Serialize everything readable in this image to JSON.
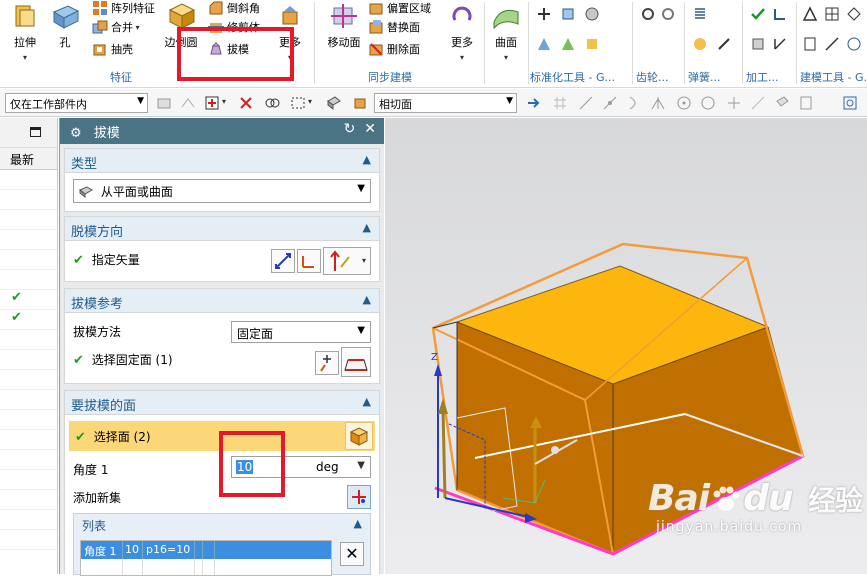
{
  "ribbon": {
    "feature_group": {
      "extrude": "拉伸",
      "hole": "孔",
      "pattern_feature": "阵列特征",
      "unite": "合并",
      "shell": "抽壳",
      "edge_blend": "边倒圆",
      "chamfer": "倒斜角",
      "trim_body": "修剪体",
      "draft": "拔模",
      "more": "更多",
      "label": "特征"
    },
    "sync_group": {
      "move_face": "移动面",
      "offset_region": "偏置区域",
      "replace_face": "替换面",
      "delete_face": "删除面",
      "more": "更多",
      "label": "同步建模"
    },
    "surface": "曲面",
    "std_parts_label": "标准化工具 - G...",
    "gear_label": "齿轮...",
    "spring_label": "弹簧...",
    "machining_label": "加工...",
    "modeling_tools_label": "建模工具 - G..."
  },
  "toolbar2": {
    "scope_filter": "仅在工作部件内",
    "face_rule": "相切面"
  },
  "navigator": {
    "column_latest": "最新",
    "checks": [
      "✔",
      "✔"
    ]
  },
  "dialog": {
    "title": "拔模",
    "sections": {
      "type": {
        "header": "类型",
        "value": "从平面或曲面"
      },
      "draw_direction": {
        "header": "脱模方向",
        "specify_vector": "指定矢量"
      },
      "draft_references": {
        "header": "拔模参考",
        "method_label": "拔模方法",
        "method_value": "固定面",
        "select_stationary": "选择固定面 (1)"
      },
      "faces_to_draft": {
        "header": "要拔模的面",
        "select_face": "选择面 (2)",
        "angle_label": "角度 1",
        "angle_value": "10",
        "angle_unit": "deg",
        "add_new_set": "添加新集",
        "list_header": "列表",
        "list_row": [
          "角度 1",
          "10",
          "p16=10",
          "",
          ""
        ]
      }
    }
  },
  "watermark": {
    "brand": "Bai",
    "brand2": "du",
    "cn": "经验",
    "url": "jingyan.baidu.com"
  },
  "colors": {
    "dialog_title_bg": "#4a7384",
    "section_header": "#1f5c8f",
    "highlight_row": "#fbd77a",
    "list_row_sel": "#3c8fe0",
    "part_face_top": "#fdb60e",
    "part_face_side": "#c87800",
    "red_annotation": "#e8182a",
    "check": "#1e9a2b"
  }
}
